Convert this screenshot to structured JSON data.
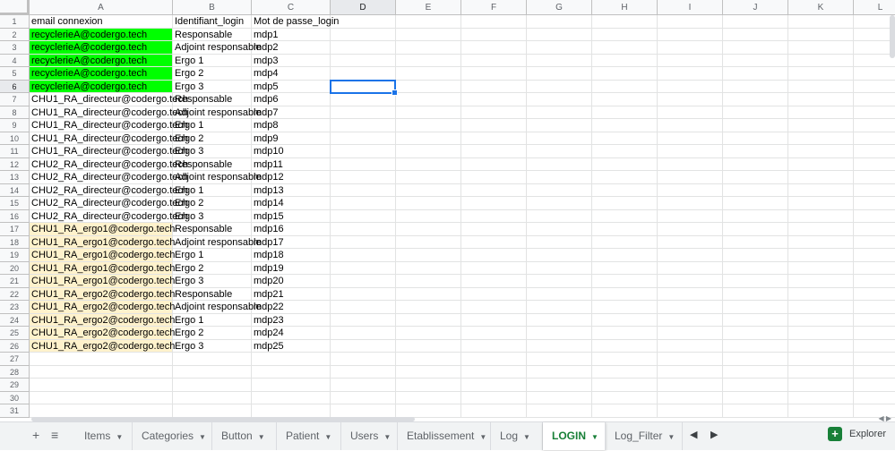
{
  "columns": [
    "A",
    "B",
    "C",
    "D",
    "E",
    "F",
    "G",
    "H",
    "I",
    "J",
    "K",
    "L"
  ],
  "rows": [
    [
      "email connexion",
      "Identifiant_login",
      "Mot de passe_login"
    ],
    [
      "recyclerieA@codergo.tech",
      "Responsable",
      "mdp1"
    ],
    [
      "recyclerieA@codergo.tech",
      "Adjoint responsable",
      "mdp2"
    ],
    [
      "recyclerieA@codergo.tech",
      "Ergo 1",
      "mdp3"
    ],
    [
      "recyclerieA@codergo.tech",
      "Ergo 2",
      "mdp4"
    ],
    [
      "recyclerieA@codergo.tech",
      "Ergo 3",
      "mdp5"
    ],
    [
      "CHU1_RA_directeur@codergo.tech",
      "Responsable",
      "mdp6"
    ],
    [
      "CHU1_RA_directeur@codergo.tech",
      "Adjoint responsable",
      "mdp7"
    ],
    [
      "CHU1_RA_directeur@codergo.tech",
      "Ergo 1",
      "mdp8"
    ],
    [
      "CHU1_RA_directeur@codergo.tech",
      "Ergo 2",
      "mdp9"
    ],
    [
      "CHU1_RA_directeur@codergo.tech",
      "Ergo 3",
      "mdp10"
    ],
    [
      "CHU2_RA_directeur@codergo.tech",
      "Responsable",
      "mdp11"
    ],
    [
      "CHU2_RA_directeur@codergo.tech",
      "Adjoint responsable",
      "mdp12"
    ],
    [
      "CHU2_RA_directeur@codergo.tech",
      "Ergo 1",
      "mdp13"
    ],
    [
      "CHU2_RA_directeur@codergo.tech",
      "Ergo 2",
      "mdp14"
    ],
    [
      "CHU2_RA_directeur@codergo.tech",
      "Ergo 3",
      "mdp15"
    ],
    [
      "CHU1_RA_ergo1@codergo.tech",
      "Responsable",
      "mdp16"
    ],
    [
      "CHU1_RA_ergo1@codergo.tech",
      "Adjoint responsable",
      "mdp17"
    ],
    [
      "CHU1_RA_ergo1@codergo.tech",
      "Ergo 1",
      "mdp18"
    ],
    [
      "CHU1_RA_ergo1@codergo.tech",
      "Ergo 2",
      "mdp19"
    ],
    [
      "CHU1_RA_ergo1@codergo.tech",
      "Ergo 3",
      "mdp20"
    ],
    [
      "CHU1_RA_ergo2@codergo.tech",
      "Responsable",
      "mdp21"
    ],
    [
      "CHU1_RA_ergo2@codergo.tech",
      "Adjoint responsable",
      "mdp22"
    ],
    [
      "CHU1_RA_ergo2@codergo.tech",
      "Ergo 1",
      "mdp23"
    ],
    [
      "CHU1_RA_ergo2@codergo.tech",
      "Ergo 2",
      "mdp24"
    ],
    [
      "CHU1_RA_ergo2@codergo.tech",
      "Ergo 3",
      "mdp25"
    ],
    [
      "",
      "",
      ""
    ],
    [
      "",
      "",
      ""
    ],
    [
      "",
      "",
      ""
    ],
    [
      "",
      "",
      ""
    ],
    [
      "",
      "",
      ""
    ]
  ],
  "row_fill": [
    "",
    "green",
    "green",
    "green",
    "green",
    "green",
    "",
    "",
    "",
    "",
    "",
    "",
    "",
    "",
    "",
    "",
    "cream",
    "cream",
    "cream",
    "cream",
    "cream",
    "cream",
    "cream",
    "cream",
    "cream",
    "cream",
    "",
    "",
    "",
    "",
    ""
  ],
  "selected_cell": "D6",
  "colors": {
    "green_fill": "#00ff00",
    "cream_fill": "#fff2cc",
    "accent": "#1a73e8",
    "active_tab": "#188038"
  },
  "tabs": [
    {
      "label": "Items"
    },
    {
      "label": "Categories"
    },
    {
      "label": "Button"
    },
    {
      "label": "Patient"
    },
    {
      "label": "Users"
    },
    {
      "label": "Etablissement"
    },
    {
      "label": "Log"
    },
    {
      "label": "LOGIN",
      "active": true
    },
    {
      "label": "Log_Filter"
    }
  ],
  "toolbar": {
    "add_icon": "plus-icon",
    "list_icon": "all-sheets-icon"
  },
  "explore": {
    "label": "Explorer",
    "icon": "explore-icon"
  }
}
